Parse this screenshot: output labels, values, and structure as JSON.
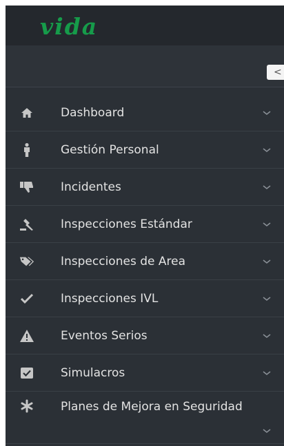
{
  "brand": {
    "logo_text": "vida",
    "color": "#169b4a"
  },
  "toggle": {
    "label": "<"
  },
  "sidebar": {
    "items": [
      {
        "label": "Dashboard",
        "icon": "home-icon"
      },
      {
        "label": "Gestión Personal",
        "icon": "person-icon"
      },
      {
        "label": "Incidentes",
        "icon": "thumbs-down-icon"
      },
      {
        "label": "Inspecciones Estándar",
        "icon": "gavel-icon"
      },
      {
        "label": "Inspecciones de Area",
        "icon": "tags-icon"
      },
      {
        "label": "Inspecciones IVL",
        "icon": "check-icon"
      },
      {
        "label": "Eventos Serios",
        "icon": "warning-icon"
      },
      {
        "label": "Simulacros",
        "icon": "checkbox-icon"
      },
      {
        "label": "Planes de Mejora en Seguridad",
        "icon": "asterisk-icon"
      }
    ]
  },
  "colors": {
    "sidebar_bg": "#2b3036",
    "header_bg": "#24282d",
    "text": "#e3e3e3",
    "icon": "#c6c6c6"
  }
}
